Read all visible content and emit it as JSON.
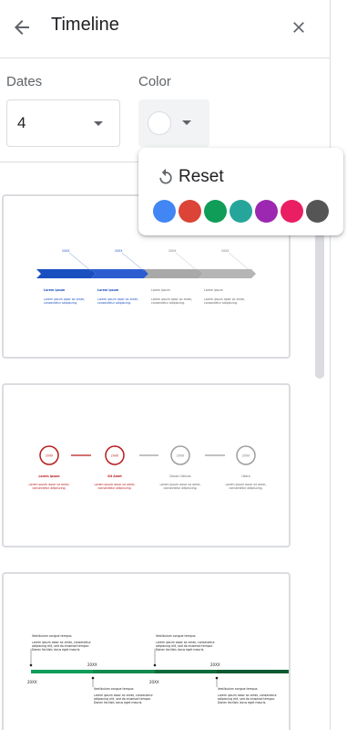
{
  "header": {
    "title": "Timeline"
  },
  "controls": {
    "dates_label": "Dates",
    "dates_value": "4",
    "color_label": "Color"
  },
  "color_menu": {
    "reset_label": "Reset",
    "colors": [
      {
        "name": "blue",
        "hex": "#4285f4"
      },
      {
        "name": "red",
        "hex": "#db4437"
      },
      {
        "name": "green",
        "hex": "#0f9d58"
      },
      {
        "name": "teal",
        "hex": "#26a69a"
      },
      {
        "name": "purple",
        "hex": "#9c27b0"
      },
      {
        "name": "pink",
        "hex": "#e91e63"
      },
      {
        "name": "dark-grey",
        "hex": "#555555"
      }
    ]
  },
  "templates": [
    {
      "style": "arrows",
      "items": [
        {
          "date": "20XX",
          "title": "Lorem ipsum",
          "text": "Lorem ipsum dolor sit amet, consectetur adipiscing."
        },
        {
          "date": "20XX",
          "title": "Lorem ipsum",
          "text": "Lorem ipsum dolor sit amet, consectetur adipiscing."
        },
        {
          "date": "20XX",
          "title": "Lorem ipsum",
          "text": "Lorem ipsum dolor sit amet, consectetur adipiscing."
        },
        {
          "date": "20XX",
          "title": "Lorem ipsum",
          "text": "Lorem ipsum dolor sit amet, consectetur adipiscing."
        }
      ]
    },
    {
      "style": "circles",
      "items": [
        {
          "date": "20XX",
          "title": "Lorem ipsum",
          "text": "Lorem ipsum dolor sit amet, consectetur adipiscing."
        },
        {
          "date": "20XX",
          "title": "Sit Amet",
          "text": "Lorem ipsum dolor sit amet, consectetur adipiscing."
        },
        {
          "date": "20XX",
          "title": "Donec Ultrices",
          "text": "Lorem ipsum dolor sit amet, consectetur adipiscing."
        },
        {
          "date": "20XX",
          "title": "Ullera",
          "text": "Lorem ipsum dolor sit amet, consectetur adipiscing."
        }
      ]
    },
    {
      "style": "bar",
      "items": [
        {
          "date": "20XX",
          "title": "Vestibulum congue tempus",
          "text": "Lorem ipsum dolor sit amet, consectetur adipiscing elit, sed do eiusmod tempor. Donec facilisis lacus eget mauris."
        },
        {
          "date": "20XX",
          "title": "Vestibulum congue tempus",
          "text": "Lorem ipsum dolor sit amet, consectetur adipiscing elit, sed do eiusmod tempor. Donec facilisis lacus eget mauris."
        },
        {
          "date": "20XX",
          "title": "Vestibulum congue tempus",
          "text": "Lorem ipsum dolor sit amet, consectetur adipiscing elit, sed do eiusmod tempor. Donec facilisis lacus eget mauris."
        },
        {
          "date": "20XX",
          "title": "Vestibulum congue tempus",
          "text": "Lorem ipsum dolor sit amet, consectetur adipiscing elit, sed do eiusmod tempor. Donec facilisis lacus eget mauris."
        }
      ]
    }
  ]
}
